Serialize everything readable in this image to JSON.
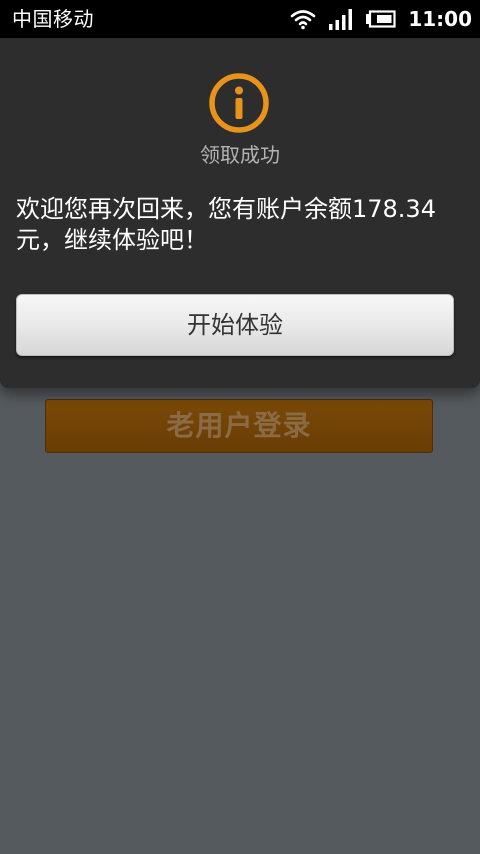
{
  "status_bar": {
    "carrier": "中国移动",
    "time": "11:00",
    "icons": [
      "wifi-icon",
      "signal-icon",
      "battery-icon"
    ]
  },
  "dialog": {
    "icon": "info-icon",
    "title": "领取成功",
    "message": "欢迎您再次回来，您有账户余额178.34元，继续体验吧！",
    "button_label": "开始体验"
  },
  "background": {
    "old_user_button_label": "老用户登录"
  },
  "colors": {
    "accent": "#e8931a",
    "dialog_bg": "#2d2d2d",
    "page_bg": "#555a5e"
  }
}
